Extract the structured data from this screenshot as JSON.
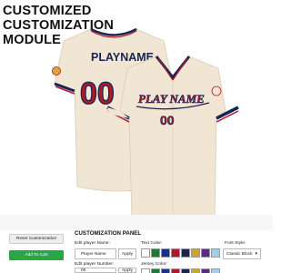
{
  "header": {
    "line1": "CUSTOMIZED",
    "line2": "CUSTOMIZATION",
    "line3": "MODULE"
  },
  "jersey": {
    "back_name": "PLAYNAME",
    "back_number": "00",
    "front_script": "PLAY NAME",
    "front_number": "00",
    "base_color": "#f1e6d3",
    "trim_navy": "#1a2450",
    "trim_red": "#b0192a"
  },
  "panel": {
    "title": "CUSTOMIZATION PANEL",
    "player_name_label": "Edit player Name:",
    "player_name_value": "Player Name",
    "player_number_label": "Edit player Number:",
    "player_number_value": "00",
    "apply_label": "Apply",
    "text_color_label": "Text Color:",
    "jersey_color_label": "Jersey Color:",
    "font_style_label": "Font Style:",
    "font_style_value": "Classic Block",
    "chevron_icon": "chevron-down-icon",
    "text_colors": [
      "#ffffff",
      "#1e7a2f",
      "#1b2f8c",
      "#b3162b",
      "#1a2450",
      "#c9a43a",
      "#5b2a86",
      "#9fd0ea"
    ],
    "jersey_colors": [
      "#ffffff",
      "#1e7a2f",
      "#1b2f8c",
      "#b3162b",
      "#1a2450",
      "#c9a43a",
      "#5b2a86",
      "#9fd0ea"
    ]
  },
  "actions": {
    "reset_label": "Reset Customization",
    "cart_label": "Add To Cart"
  }
}
